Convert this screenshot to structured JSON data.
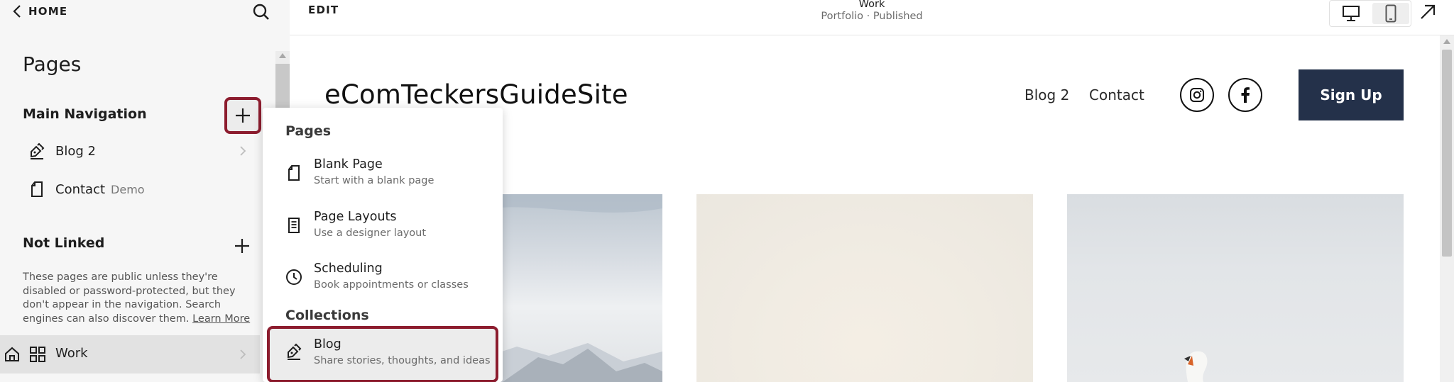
{
  "sidebar": {
    "home_label": "HOME",
    "title": "Pages",
    "main_navigation": {
      "heading": "Main Navigation",
      "items": [
        {
          "label": "Blog 2",
          "icon": "blog-icon"
        },
        {
          "label": "Contact",
          "tag": "Demo",
          "icon": "page-icon"
        }
      ]
    },
    "not_linked": {
      "heading": "Not Linked",
      "help_text": "These pages are public unless they're disabled or password-protected, but they don't appear in the navigation. Search engines can also discover them.",
      "learn_more": "Learn More",
      "items": [
        {
          "label": "Work",
          "icon": "grid-icon"
        }
      ]
    }
  },
  "topbar": {
    "edit_label": "EDIT",
    "page_name": "Work",
    "page_status": "Portfolio · Published"
  },
  "site": {
    "title": "eComTeckersGuideSite",
    "nav": [
      "Blog 2",
      "Contact"
    ],
    "signup_label": "Sign Up"
  },
  "add_menu": {
    "pages_heading": "Pages",
    "pages": [
      {
        "title": "Blank Page",
        "subtitle": "Start with a blank page",
        "icon": "blank-page-icon"
      },
      {
        "title": "Page Layouts",
        "subtitle": "Use a designer layout",
        "icon": "layouts-icon"
      },
      {
        "title": "Scheduling",
        "subtitle": "Book appointments or classes",
        "icon": "clock-icon"
      }
    ],
    "collections_heading": "Collections",
    "collections": [
      {
        "title": "Blog",
        "subtitle": "Share stories, thoughts, and ideas",
        "icon": "blog-icon"
      }
    ]
  },
  "colors": {
    "highlight_border": "#8c1c2e",
    "signup_bg": "#24314a",
    "sidebar_bg": "#f6f6f6",
    "selected_row": "#e2e2e2"
  }
}
